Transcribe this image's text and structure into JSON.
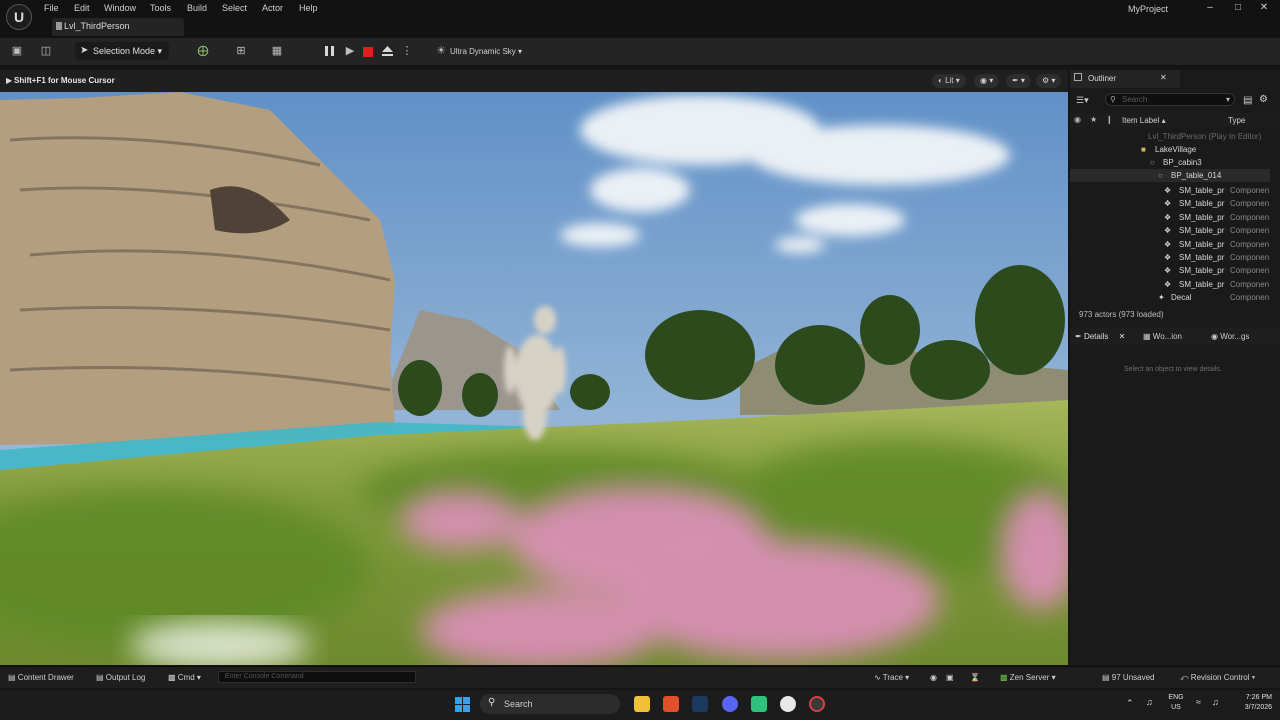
{
  "window": {
    "project": "MyProject",
    "level_tab": "Lvl_ThirdPerson",
    "menus": [
      "File",
      "Edit",
      "Window",
      "Tools",
      "Build",
      "Select",
      "Actor",
      "Help"
    ]
  },
  "toolbar": {
    "selection_mode": "Selection Mode",
    "sky": "Ultra Dynamic Sky"
  },
  "viewport": {
    "hint": "Shift+F1 for Mouse Cursor",
    "view_mode": "Lit"
  },
  "outliner": {
    "tab": "Outliner",
    "search_placeholder": "Search",
    "col_label": "Item Label",
    "col_type": "Type",
    "rows": [
      {
        "label": "Lvl_ThirdPerson (Play In Editor)",
        "type": ""
      },
      {
        "label": "LakeVillage",
        "type": ""
      },
      {
        "label": "BP_cabin3",
        "type": ""
      },
      {
        "label": "BP_table_014",
        "type": ""
      },
      {
        "label": "SM_table_pr",
        "type": "Componen"
      },
      {
        "label": "SM_table_pr",
        "type": "Componen"
      },
      {
        "label": "SM_table_pr",
        "type": "Componen"
      },
      {
        "label": "SM_table_pr",
        "type": "Componen"
      },
      {
        "label": "SM_table_pr",
        "type": "Componen"
      },
      {
        "label": "SM_table_pr",
        "type": "Componen"
      },
      {
        "label": "SM_table_pr",
        "type": "Componen"
      },
      {
        "label": "SM_table_pr",
        "type": "Componen"
      },
      {
        "label": "Decal",
        "type": "Componen"
      }
    ],
    "actors": "973 actors (973 loaded)"
  },
  "details": {
    "tabs": [
      "Details",
      "Wo...ion",
      "Wor...gs"
    ],
    "empty": "Select an object to view details."
  },
  "statusbar": {
    "content_drawer": "Content Drawer",
    "output_log": "Output Log",
    "cmd": "Cmd",
    "console_placeholder": "Enter Console Command",
    "trace": "Trace",
    "zen": "Zen Server",
    "unsaved": "97 Unsaved",
    "revision": "Revision Control"
  },
  "taskbar": {
    "search": "Search",
    "lang1": "ENG",
    "lang2": "US",
    "time": "7:26 PM",
    "date": "3/7/2026"
  },
  "colors": {
    "stop": "#e02020",
    "selected_row": "#f0c040",
    "water": "#3fb8c8"
  }
}
